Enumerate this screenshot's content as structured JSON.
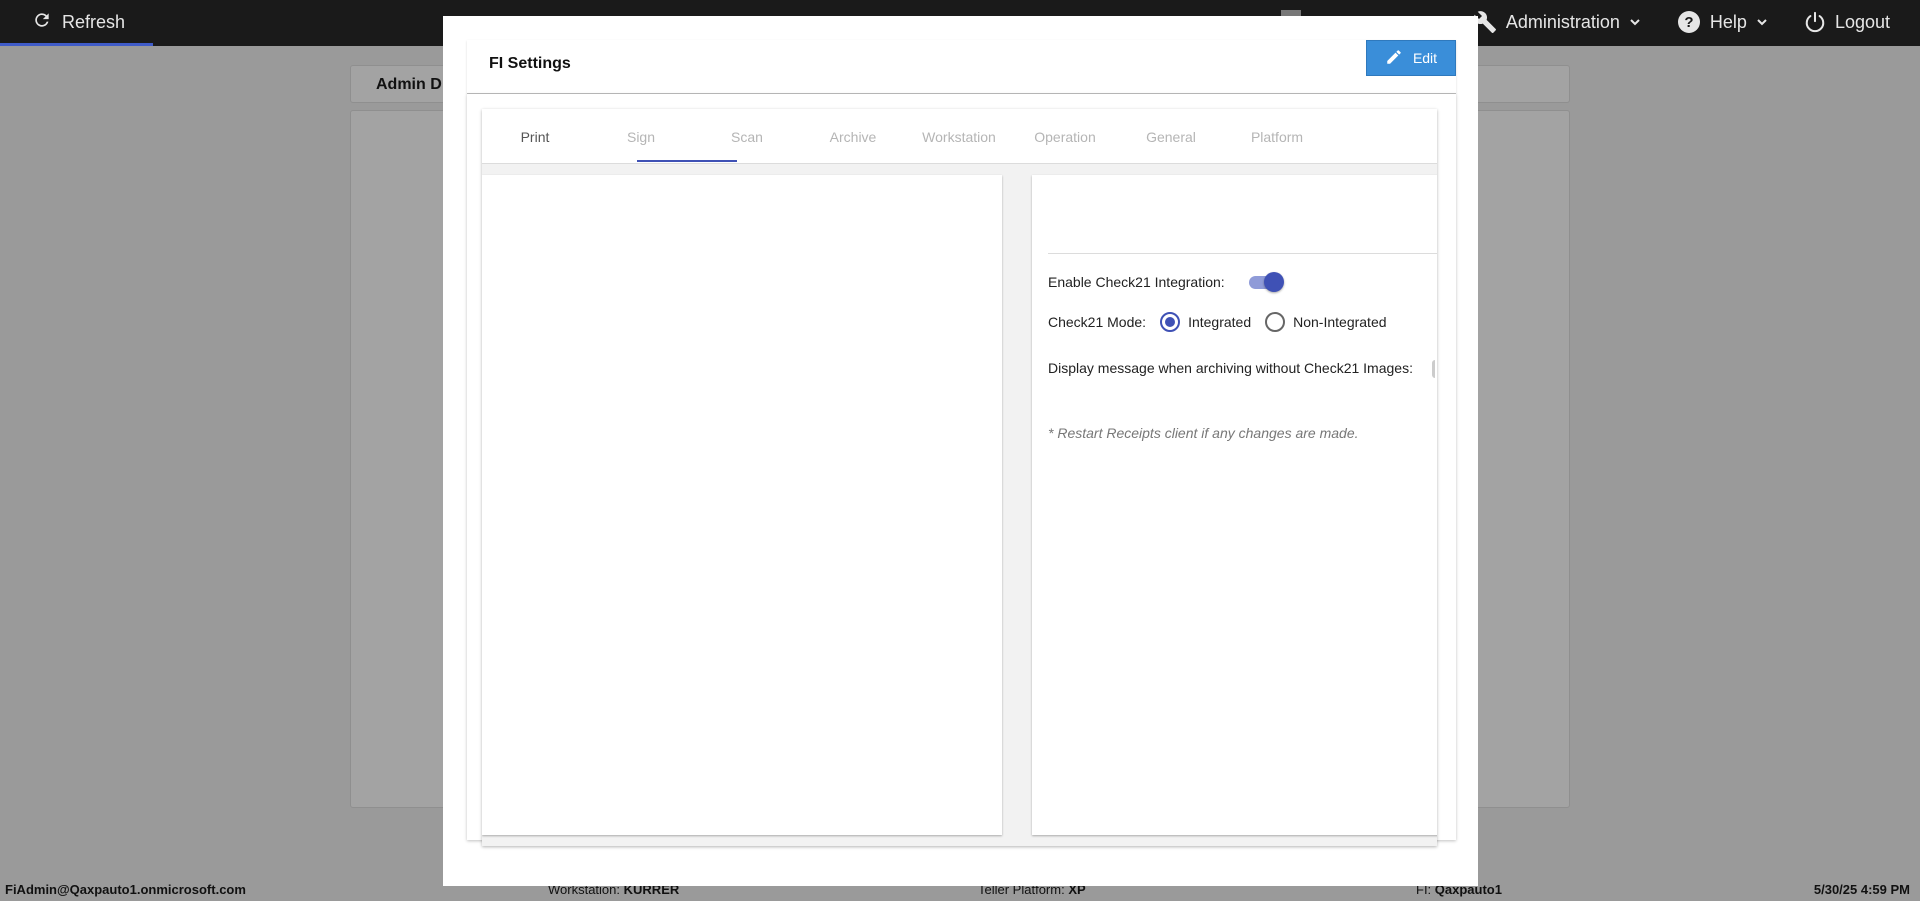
{
  "topbar": {
    "refresh_label": "Refresh",
    "administration_label": "Administration",
    "help_label": "Help",
    "logout_label": "Logout"
  },
  "background": {
    "header_title": "Admin D"
  },
  "statusbar": {
    "user": "FiAdmin@Qaxpauto1.onmicrosoft.com",
    "workstation_label": "Workstation:",
    "workstation_value": "KURRER",
    "teller_label": "Teller Platform:",
    "teller_value": "XP",
    "fi_label": "FI:",
    "fi_value": "Qaxpauto1",
    "datetime": "5/30/25 4:59 PM"
  },
  "modal": {
    "title": "FI Settings",
    "edit_label": "Edit",
    "tabs": [
      {
        "label": "Print"
      },
      {
        "label": "Sign"
      },
      {
        "label": "Scan"
      },
      {
        "label": "Archive"
      },
      {
        "label": "Workstation"
      },
      {
        "label": "Operation"
      },
      {
        "label": "General"
      },
      {
        "label": "Platform"
      }
    ],
    "settings": {
      "enable_check21_label": "Enable Check21 Integration:",
      "enable_check21_value": true,
      "check21_mode_label": "Check21 Mode:",
      "mode_options": [
        "Integrated",
        "Non-Integrated"
      ],
      "mode_selected": "Integrated",
      "display_message_label": "Display message when archiving without Check21 Images:",
      "restart_note": "* Restart Receipts client if any changes are made."
    }
  },
  "colors": {
    "accent": "#3f51b5",
    "edit_button": "#3a8ed9",
    "topbar": "#1a1a1a",
    "overlay_bg": "#9a9a9a"
  }
}
